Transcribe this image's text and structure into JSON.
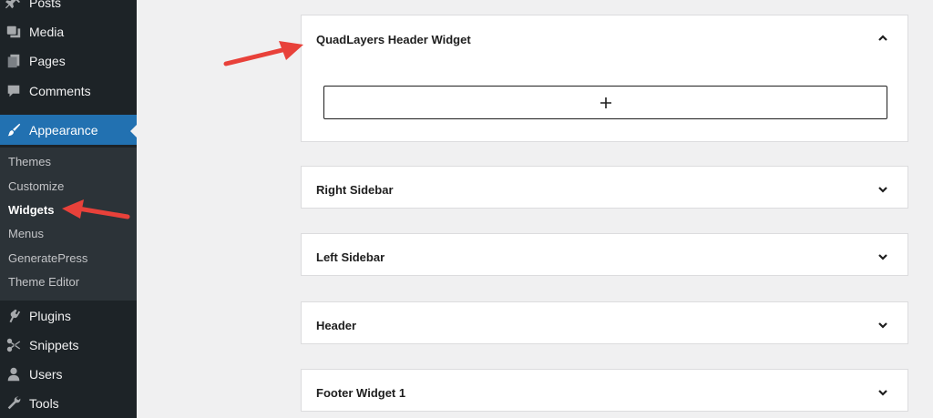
{
  "sidebar": {
    "items": [
      {
        "label": "Posts",
        "icon": "pin-icon"
      },
      {
        "label": "Media",
        "icon": "media-icon"
      },
      {
        "label": "Pages",
        "icon": "pages-icon"
      },
      {
        "label": "Comments",
        "icon": "comment-icon"
      },
      {
        "label": "Appearance",
        "icon": "paintbrush-icon",
        "active": true
      },
      {
        "label": "Plugins",
        "icon": "plugin-icon"
      },
      {
        "label": "Snippets",
        "icon": "scissors-icon"
      },
      {
        "label": "Users",
        "icon": "user-icon"
      },
      {
        "label": "Tools",
        "icon": "wrench-icon"
      }
    ],
    "submenu": [
      {
        "label": "Themes"
      },
      {
        "label": "Customize"
      },
      {
        "label": "Widgets",
        "current": true
      },
      {
        "label": "Menus"
      },
      {
        "label": "GeneratePress"
      },
      {
        "label": "Theme Editor"
      }
    ]
  },
  "widget_areas": [
    {
      "title": "QuadLayers Header Widget",
      "expanded": true
    },
    {
      "title": "Right Sidebar",
      "expanded": false
    },
    {
      "title": "Left Sidebar",
      "expanded": false
    },
    {
      "title": "Header",
      "expanded": false
    },
    {
      "title": "Footer Widget 1",
      "expanded": false
    }
  ],
  "colors": {
    "sidebar_bg": "#1d2327",
    "submenu_bg": "#2c3338",
    "accent": "#2271b1",
    "annotation_arrow": "#e8413a"
  }
}
